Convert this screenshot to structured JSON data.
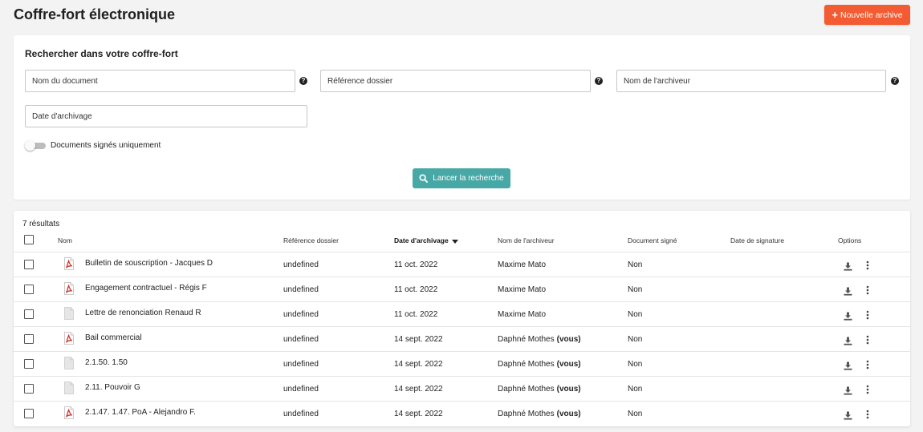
{
  "page": {
    "title": "Coffre-fort électronique",
    "new_button_label": "Nouvelle archive",
    "new_button_icon": "plus-icon",
    "accent_color": "#f35b32"
  },
  "search": {
    "title": "Rechercher dans votre coffre-fort",
    "fields": {
      "document_name": {
        "placeholder": "Nom du document",
        "value": ""
      },
      "folder_reference": {
        "placeholder": "Référence dossier",
        "value": ""
      },
      "archiver_name": {
        "placeholder": "Nom de l'archiveur",
        "value": ""
      },
      "archive_date": {
        "placeholder": "Date d'archivage",
        "value": ""
      }
    },
    "signed_only": {
      "label": "Documents signés uniquement",
      "checked": false
    },
    "submit_label": "Lancer la recherche",
    "submit_color": "#48a8a6"
  },
  "results": {
    "count_label": "7 résultats",
    "columns": {
      "name": "Nom",
      "folder_reference": "Référence dossier",
      "archive_date": "Date d'archivage",
      "archiver_name": "Nom de l'archiveur",
      "signed": "Document signé",
      "signature_date": "Date de signature",
      "options": "Options"
    },
    "sort": {
      "column": "archive_date",
      "direction": "desc"
    },
    "rows": [
      {
        "name": "Bulletin de souscription - Jacques D",
        "type": "pdf",
        "reference": "undefined",
        "archive_date": "11 oct. 2022",
        "archiver": "Maxime Mato",
        "you": "",
        "signed": "Non",
        "signature_date": ""
      },
      {
        "name": "Engagement contractuel - Régis F",
        "type": "pdf",
        "reference": "undefined",
        "archive_date": "11 oct. 2022",
        "archiver": "Maxime Mato",
        "you": "",
        "signed": "Non",
        "signature_date": ""
      },
      {
        "name": "Lettre de renonciation Renaud R",
        "type": "file",
        "reference": "undefined",
        "archive_date": "11 oct. 2022",
        "archiver": "Maxime Mato",
        "you": "",
        "signed": "Non",
        "signature_date": ""
      },
      {
        "name": "Bail commercial",
        "type": "pdf",
        "reference": "undefined",
        "archive_date": "14 sept. 2022",
        "archiver": "Daphné Mothes",
        "you": "(vous)",
        "signed": "Non",
        "signature_date": ""
      },
      {
        "name": "2.1.50. 1.50",
        "type": "file",
        "reference": "undefined",
        "archive_date": "14 sept. 2022",
        "archiver": "Daphné Mothes",
        "you": "(vous)",
        "signed": "Non",
        "signature_date": ""
      },
      {
        "name": "2.11. Pouvoir G",
        "type": "file",
        "reference": "undefined",
        "archive_date": "14 sept. 2022",
        "archiver": "Daphné Mothes",
        "you": "(vous)",
        "signed": "Non",
        "signature_date": ""
      },
      {
        "name": "2.1.47. 1.47. PoA - Alejandro F.",
        "type": "pdf",
        "reference": "undefined",
        "archive_date": "14 sept. 2022",
        "archiver": "Daphné Mothes",
        "you": "(vous)",
        "signed": "Non",
        "signature_date": ""
      }
    ]
  }
}
